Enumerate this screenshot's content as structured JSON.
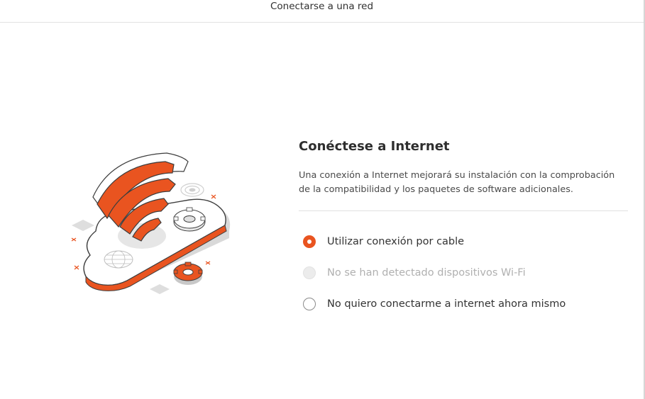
{
  "window": {
    "title": "Conectarse a una red"
  },
  "page": {
    "heading": "Conéctese a Internet",
    "description": "Una conexión a Internet mejorará su instalación con la comprobación de la compatibilidad y los paquetes de software adicionales."
  },
  "options": [
    {
      "label": "Utilizar conexión por cable",
      "state": "selected"
    },
    {
      "label": "No se han detectado dispositivos Wi-Fi",
      "state": "disabled"
    },
    {
      "label": "No quiero conectarme a internet ahora mismo",
      "state": "unselected"
    }
  ],
  "illustration": {
    "icon": "cloud-wifi-illustration",
    "colors": {
      "accent": "#e95420",
      "outline": "#3d3d3d",
      "shadow": "#dcdcdc"
    }
  },
  "colors": {
    "accent": "#e95420",
    "text": "#333333",
    "disabled_text": "#b0b0b0"
  }
}
